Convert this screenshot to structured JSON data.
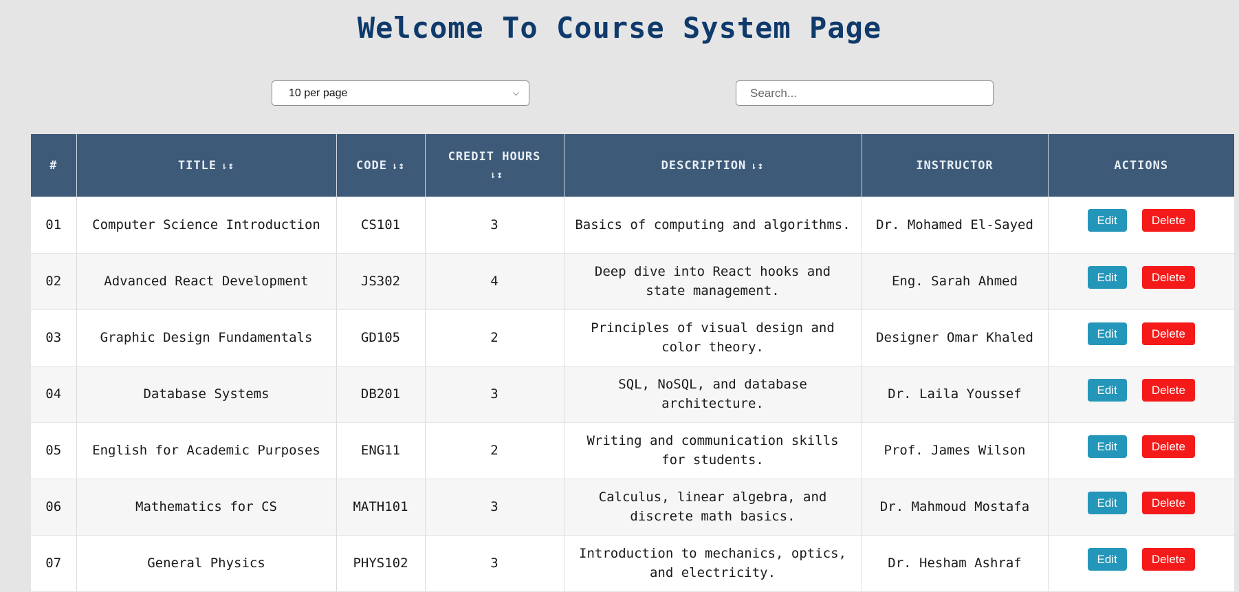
{
  "page": {
    "title": "Welcome To Course System Page"
  },
  "controls": {
    "per_page_value": "10 per page",
    "search_placeholder": "Search..."
  },
  "table": {
    "headers": {
      "num": "#",
      "title": "TITLE",
      "code": "CODE",
      "credit_hours": "CREDIT HOURS",
      "description": "DESCRIPTION",
      "instructor": "INSTRUCTOR",
      "actions": "ACTIONS"
    },
    "sort_icon": "⇂↕",
    "rows": [
      {
        "num": "01",
        "title": "Computer Science Introduction",
        "code": "CS101",
        "credit": "3",
        "desc": "Basics of computing and algorithms.",
        "instructor": "Dr. Mohamed El-Sayed"
      },
      {
        "num": "02",
        "title": "Advanced React Development",
        "code": "JS302",
        "credit": "4",
        "desc": "Deep dive into React hooks and state management.",
        "instructor": "Eng. Sarah Ahmed"
      },
      {
        "num": "03",
        "title": "Graphic Design Fundamentals",
        "code": "GD105",
        "credit": "2",
        "desc": "Principles of visual design and color theory.",
        "instructor": "Designer Omar Khaled"
      },
      {
        "num": "04",
        "title": "Database Systems",
        "code": "DB201",
        "credit": "3",
        "desc": "SQL, NoSQL, and database architecture.",
        "instructor": "Dr. Laila Youssef"
      },
      {
        "num": "05",
        "title": "English for Academic Purposes",
        "code": "ENG11",
        "credit": "2",
        "desc": "Writing and communication skills for students.",
        "instructor": "Prof. James Wilson"
      },
      {
        "num": "06",
        "title": "Mathematics for CS",
        "code": "MATH101",
        "credit": "3",
        "desc": "Calculus, linear algebra, and discrete math basics.",
        "instructor": "Dr. Mahmoud Mostafa"
      },
      {
        "num": "07",
        "title": "General Physics",
        "code": "PHYS102",
        "credit": "3",
        "desc": "Introduction to mechanics, optics, and electricity.",
        "instructor": "Dr. Hesham Ashraf"
      }
    ],
    "edit_label": "Edit",
    "delete_label": "Delete"
  }
}
